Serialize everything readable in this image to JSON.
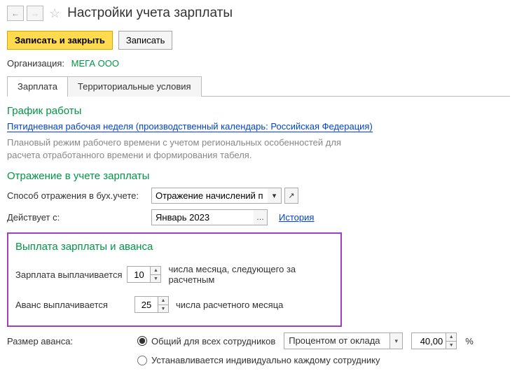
{
  "header": {
    "title": "Настройки учета зарплаты"
  },
  "actions": {
    "save_close": "Записать и закрыть",
    "save": "Записать"
  },
  "org": {
    "label": "Организация:",
    "value": "МЕГА ООО"
  },
  "tabs": {
    "salary": "Зарплата",
    "territory": "Территориальные условия"
  },
  "schedule": {
    "title": "График работы",
    "link": "Пятидневная рабочая неделя (производственный календарь: Российская Федерация)",
    "help": "Плановый режим рабочего времени с учетом региональных особенностей для расчета отработанного времени и формирования табеля."
  },
  "accounting": {
    "title": "Отражение в учете зарплаты",
    "method_label": "Способ отражения в бух.учете:",
    "method_value": "Отражение начислений п",
    "effective_label": "Действует с:",
    "effective_value": "Январь 2023",
    "history": "История"
  },
  "payment": {
    "title": "Выплата зарплаты и аванса",
    "salary_label": "Зарплата выплачивается",
    "salary_day": "10",
    "salary_note": "числа месяца, следующего за расчетным",
    "advance_label": "Аванс выплачивается",
    "advance_day": "25",
    "advance_note": "числа расчетного месяца"
  },
  "advance_size": {
    "label": "Размер аванса:",
    "option_common": "Общий для всех сотрудников",
    "option_individual": "Устанавливается индивидуально каждому сотруднику",
    "method": "Процентом от оклада",
    "percent": "40,00",
    "percent_sign": "%"
  }
}
